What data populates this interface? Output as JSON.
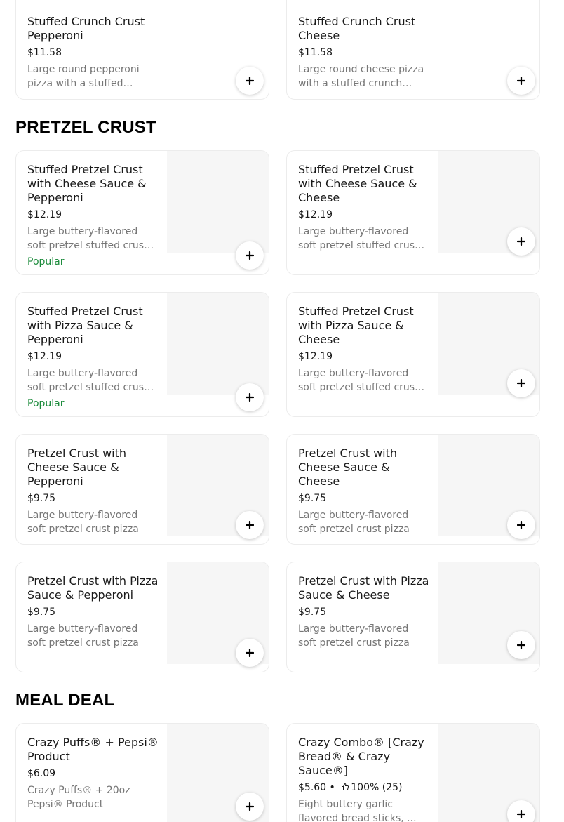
{
  "sections": [
    {
      "title": "",
      "items": [
        {
          "name": "Stuffed Crunch Crust Pepperoni",
          "price": "$11.58",
          "description": "Large round pepperoni pizza with a stuffed crunch crust",
          "badge": ""
        },
        {
          "name": "Stuffed Crunch Crust Cheese",
          "price": "$11.58",
          "description": "Large round cheese pizza with a stuffed crunch crust",
          "badge": ""
        }
      ]
    },
    {
      "title": "PRETZEL CRUST",
      "items": [
        {
          "name": "Stuffed Pretzel Crust with Cheese Sauce & Pepperoni",
          "price": "$12.19",
          "description": "Large buttery-flavored soft pretzel stuffed crust pizza",
          "badge": "Popular"
        },
        {
          "name": "Stuffed Pretzel Crust with Cheese Sauce & Cheese",
          "price": "$12.19",
          "description": "Large buttery-flavored soft pretzel stuffed crust pizza",
          "badge": ""
        },
        {
          "name": "Stuffed Pretzel Crust with Pizza Sauce & Pepperoni",
          "price": "$12.19",
          "description": "Large buttery-flavored soft pretzel stuffed crust pizza",
          "badge": "Popular"
        },
        {
          "name": "Stuffed Pretzel Crust with Pizza Sauce & Cheese",
          "price": "$12.19",
          "description": "Large buttery-flavored soft pretzel stuffed crust pizza",
          "badge": ""
        },
        {
          "name": "Pretzel Crust with Cheese Sauce & Pepperoni",
          "price": "$9.75",
          "description": "Large buttery-flavored soft pretzel crust pizza",
          "badge": ""
        },
        {
          "name": "Pretzel Crust with Cheese Sauce & Cheese",
          "price": "$9.75",
          "description": "Large buttery-flavored soft pretzel crust pizza",
          "badge": ""
        },
        {
          "name": "Pretzel Crust with Pizza Sauce & Pepperoni",
          "price": "$9.75",
          "description": "Large buttery-flavored soft pretzel crust pizza",
          "badge": ""
        },
        {
          "name": "Pretzel Crust with Pizza Sauce & Cheese",
          "price": "$9.75",
          "description": "Large buttery-flavored soft pretzel crust pizza",
          "badge": ""
        }
      ]
    },
    {
      "title": "MEAL DEAL",
      "items": [
        {
          "name": "Crazy Puffs® + Pepsi® Product",
          "price": "$6.09",
          "description": "Crazy Puffs® + 20oz Pepsi® Product",
          "badge": ""
        },
        {
          "name": "Crazy Combo® [Crazy Bread® & Crazy Sauce®]",
          "price": "$5.60",
          "rating": "100% (25)",
          "description": "Eight buttery garlic flavored bread sticks, ...",
          "badge": ""
        }
      ]
    }
  ],
  "icons": {
    "add": "plus-icon",
    "rating": "thumbs-up-icon"
  },
  "colors": {
    "badge": "#1a8a3a",
    "muted": "#767676",
    "placeholder": "#f6f6f6"
  }
}
